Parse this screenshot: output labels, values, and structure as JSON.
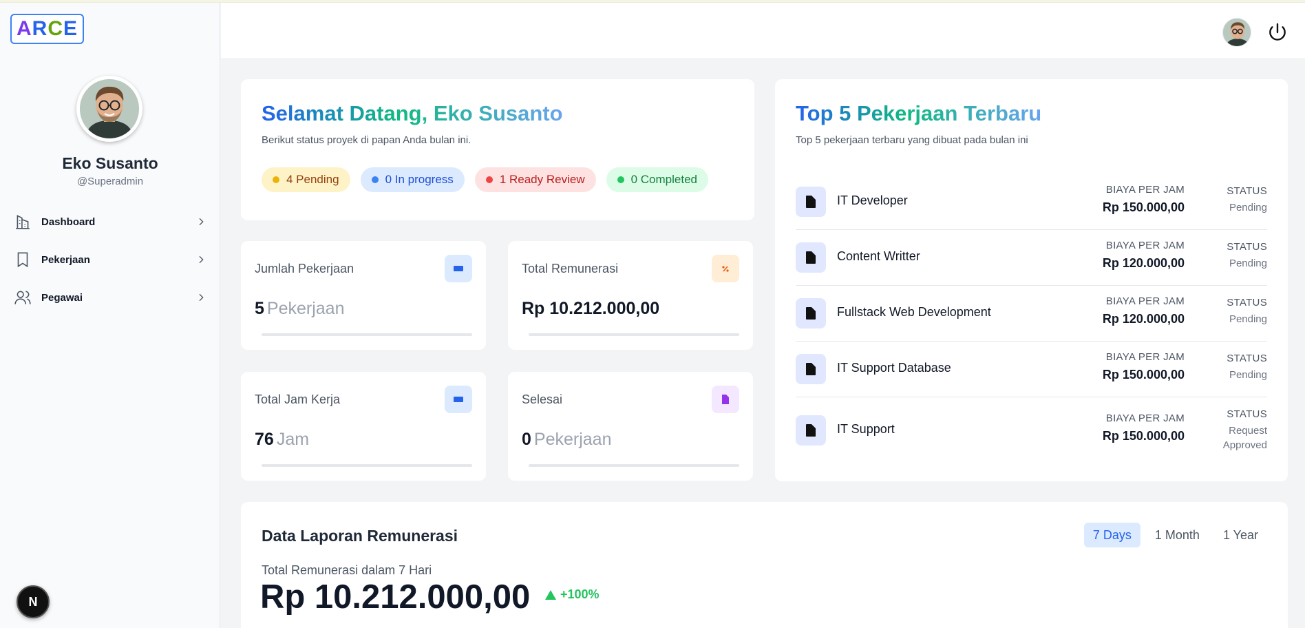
{
  "app": {
    "logo_letters": [
      {
        "char": "A",
        "color": "#7c3aed"
      },
      {
        "char": "R",
        "color": "#2563eb"
      },
      {
        "char": "C",
        "color": "#65a30d"
      },
      {
        "char": "E",
        "color": "#2563eb"
      }
    ]
  },
  "profile": {
    "name": "Eko Susanto",
    "handle": "@Superadmin"
  },
  "sidebar": {
    "items": [
      {
        "label": "Dashboard",
        "icon": "building-chart-icon"
      },
      {
        "label": "Pekerjaan",
        "icon": "bookmark-icon"
      },
      {
        "label": "Pegawai",
        "icon": "users-icon"
      }
    ],
    "dev_badge": "N"
  },
  "welcome": {
    "title_prefix": "Selamat Datang, ",
    "title_name": "Eko Susanto",
    "subtitle": "Berikut status proyek di papan Anda bulan ini.",
    "pills": [
      {
        "label": "4 Pending",
        "bg": "#fef3c7",
        "fg": "#92400e",
        "dot": "#eab308"
      },
      {
        "label": "0 In progress",
        "bg": "#dbeafe",
        "fg": "#1d4ed8",
        "dot": "#3b82f6"
      },
      {
        "label": "1 Ready Review",
        "bg": "#fee2e2",
        "fg": "#b91c1c",
        "dot": "#ef4444"
      },
      {
        "label": "0 Completed",
        "bg": "#dcfce7",
        "fg": "#15803d",
        "dot": "#22c55e"
      }
    ]
  },
  "stats": [
    {
      "title": "Jumlah Pekerjaan",
      "value": "5",
      "unit": "Pekerjaan",
      "icon": "id-card-icon",
      "icon_bg": "#dbeafe",
      "icon_fg": "#2563eb"
    },
    {
      "title": "Total Remunerasi",
      "value": "Rp 10.212.000,00",
      "unit": "",
      "icon": "percent-icon",
      "icon_bg": "#ffedd5",
      "icon_fg": "#ea580c"
    },
    {
      "title": "Total Jam Kerja",
      "value": "76",
      "unit": "Jam",
      "icon": "id-card-icon",
      "icon_bg": "#dbeafe",
      "icon_fg": "#2563eb"
    },
    {
      "title": "Selesai",
      "value": "0",
      "unit": "Pekerjaan",
      "icon": "file-icon",
      "icon_bg": "#f3e8ff",
      "icon_fg": "#9333ea"
    }
  ],
  "top5": {
    "title": "Top 5 Pekerjaan Terbaru",
    "subtitle": "Top 5 pekerjaan terbaru yang dibuat pada bulan ini",
    "rate_label": "BIAYA PER JAM",
    "status_label": "STATUS",
    "jobs": [
      {
        "name": "IT Developer",
        "rate": "Rp 150.000,00",
        "status": "Pending"
      },
      {
        "name": "Content Writter",
        "rate": "Rp 120.000,00",
        "status": "Pending"
      },
      {
        "name": "Fullstack Web Development",
        "rate": "Rp 120.000,00",
        "status": "Pending"
      },
      {
        "name": "IT Support Database",
        "rate": "Rp 150.000,00",
        "status": "Pending"
      },
      {
        "name": "IT Support",
        "rate": "Rp 150.000,00",
        "status": "Request Approved"
      }
    ]
  },
  "report": {
    "title": "Data Laporan Remunerasi",
    "tabs": [
      "7 Days",
      "1 Month",
      "1 Year"
    ],
    "active_tab": "7 Days",
    "subtitle": "Total Remunerasi dalam 7 Hari",
    "total": "Rp 10.212.000,00",
    "change": "+100%"
  }
}
